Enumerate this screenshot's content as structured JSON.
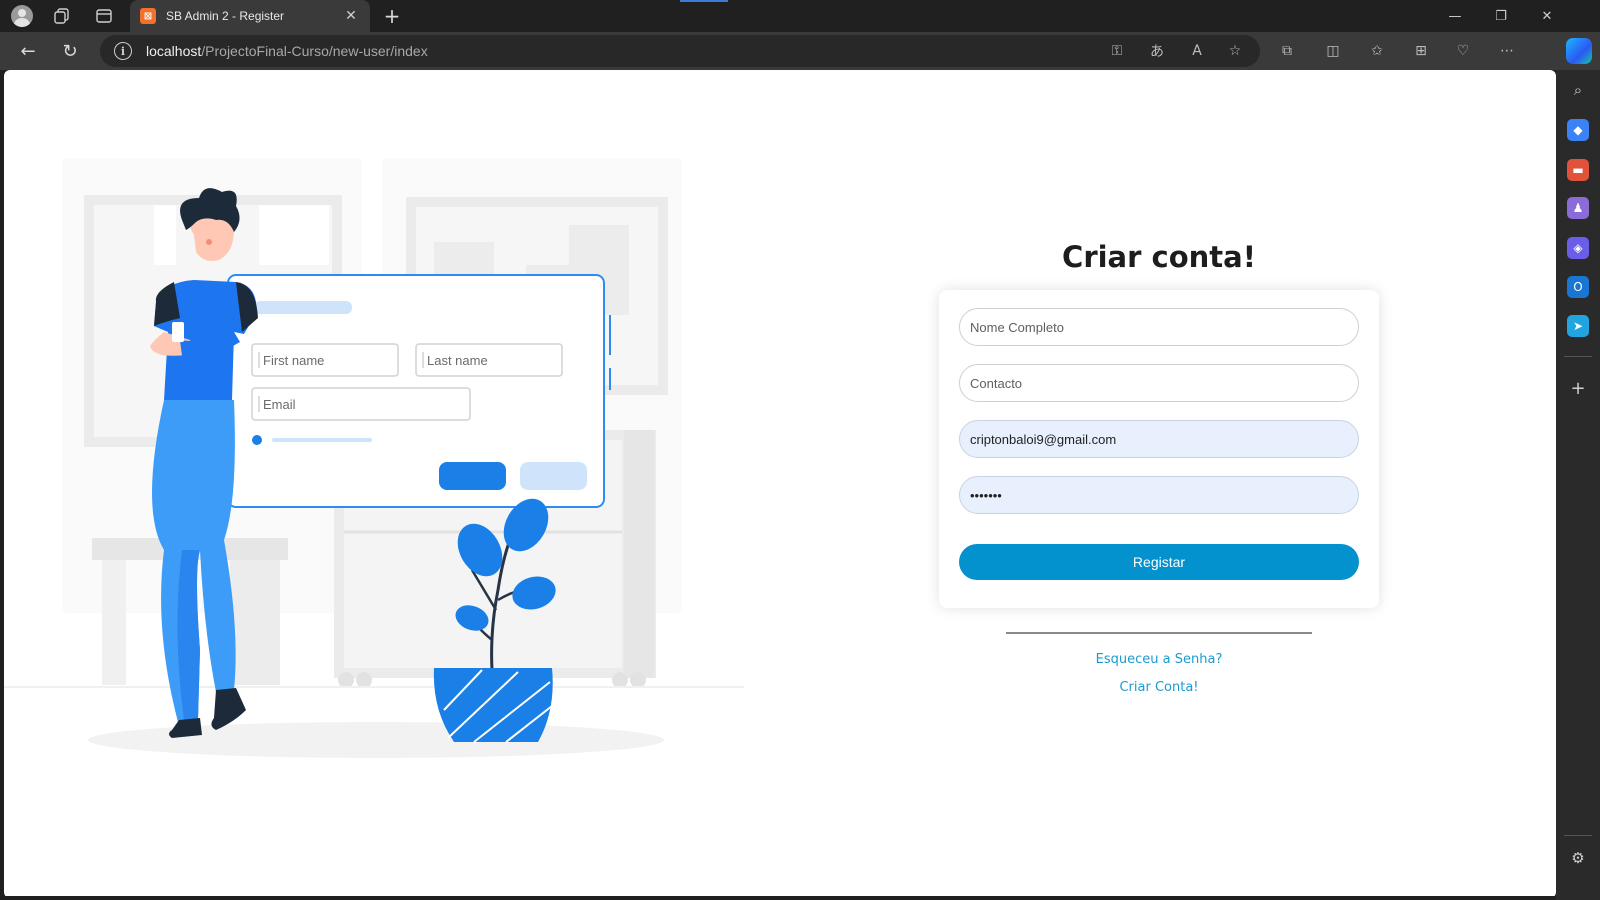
{
  "browser": {
    "tab_title": "SB Admin 2 - Register",
    "tab_favicon": "xampp-icon",
    "url_host": "localhost",
    "url_path": "/ProjectoFinal-Curso/new-user/index",
    "accent_color": "#3a7bd5"
  },
  "illustration": {
    "first_name_placeholder": "First name",
    "last_name_placeholder": "Last name",
    "email_placeholder": "Email"
  },
  "register": {
    "title": "Criar conta!",
    "fields": {
      "name_placeholder": "Nome Completo",
      "contact_placeholder": "Contacto",
      "email_value": "criptonbaloi9@gmail.com",
      "password_value": "•••••••"
    },
    "submit_label": "Registar",
    "forgot_link": "Esqueceu a Senha?",
    "create_link": "Criar Conta!",
    "button_color": "#0392ce",
    "link_color": "#1d9bd1"
  }
}
